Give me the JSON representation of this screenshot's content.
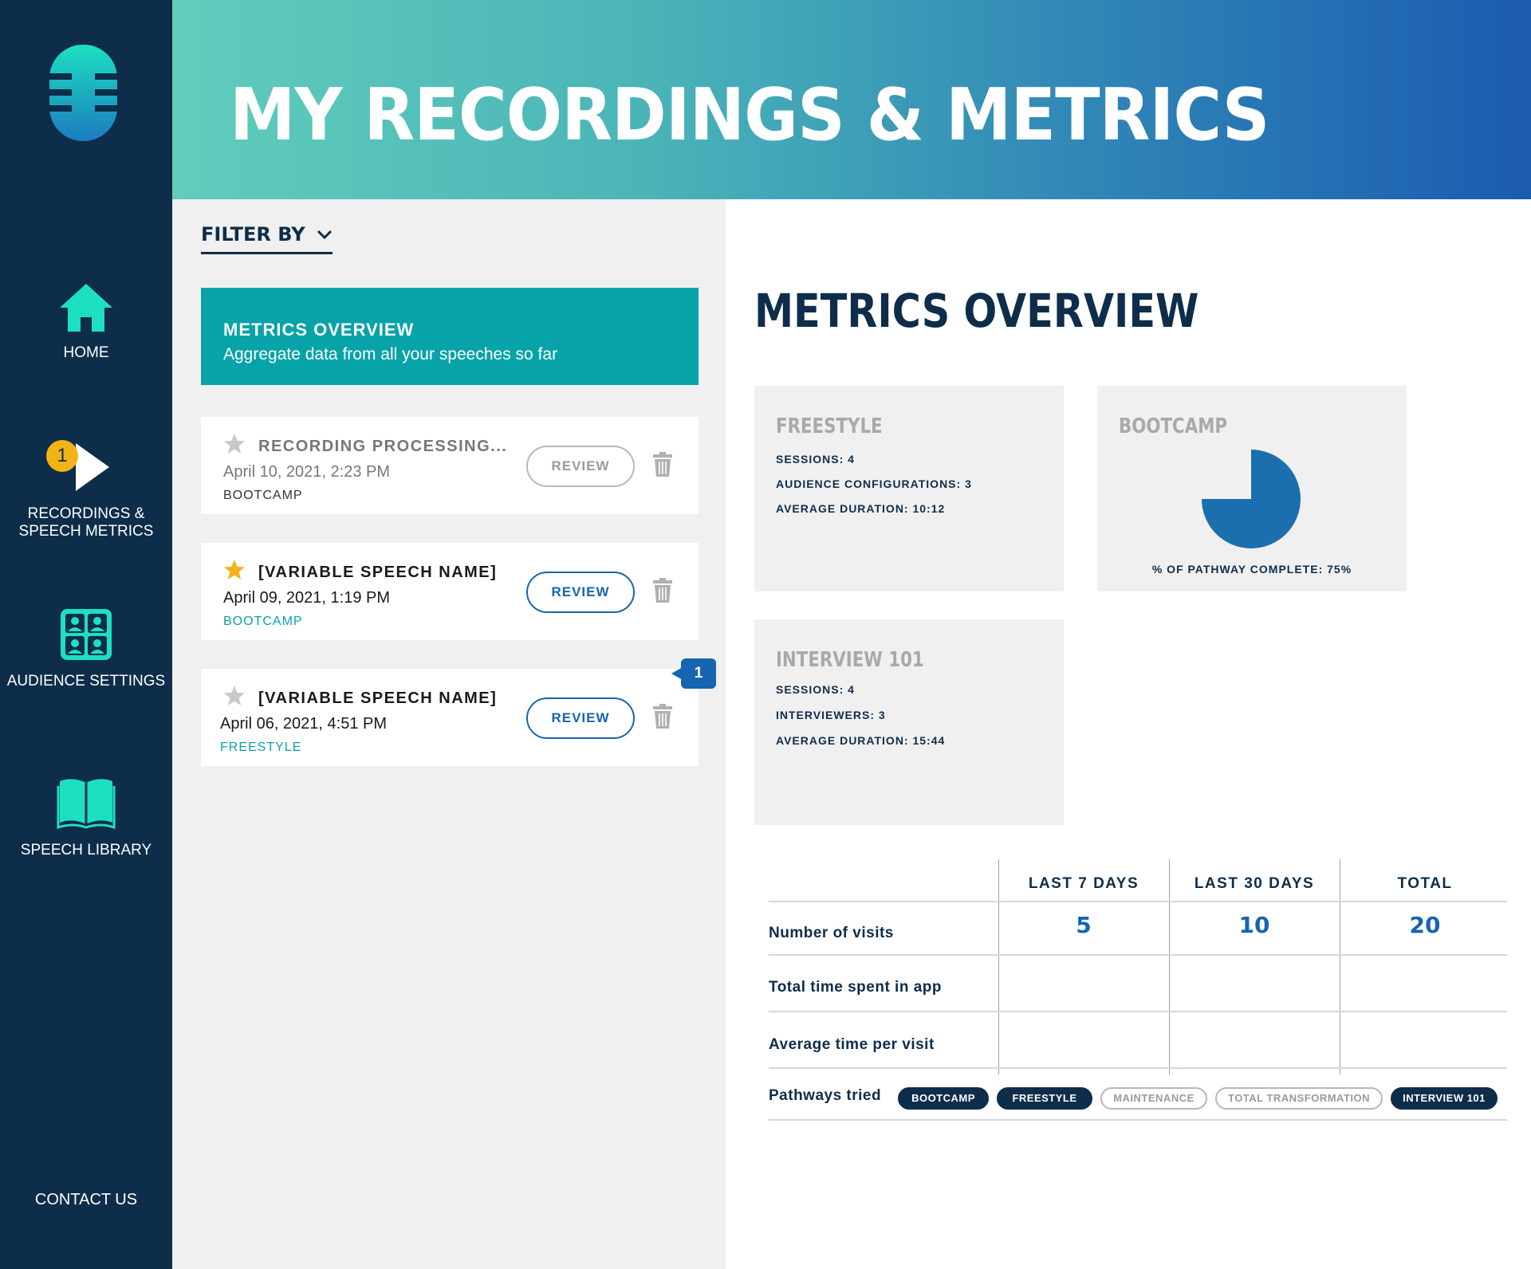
{
  "header": {
    "title": "MY RECORDINGS & METRICS"
  },
  "sidebar": {
    "items": [
      {
        "label": "HOME",
        "icon": "home-icon"
      },
      {
        "label": "RECORDINGS & SPEECH METRICS",
        "icon": "play-icon",
        "badge": "1"
      },
      {
        "label": "AUDIENCE SETTINGS",
        "icon": "audience-grid-icon"
      },
      {
        "label": "SPEECH LIBRARY",
        "icon": "book-icon"
      }
    ],
    "contact": "CONTACT US"
  },
  "filter": {
    "label": "FILTER BY"
  },
  "overview_card": {
    "title": "METRICS OVERVIEW",
    "subtitle": "Aggregate data from all your speeches so far"
  },
  "recordings": [
    {
      "title": "RECORDING PROCESSING...",
      "date": "April 10, 2021, 2:23 PM",
      "tag": "BOOTCAMP",
      "starred": false,
      "review": "REVIEW",
      "state": "processing"
    },
    {
      "title": "[VARIABLE SPEECH NAME]",
      "date": "April 09, 2021, 1:19 PM",
      "tag": "BOOTCAMP",
      "starred": true,
      "review": "REVIEW",
      "state": "ready"
    },
    {
      "title": "[VARIABLE SPEECH NAME]",
      "date": "April 06, 2021, 4:51 PM",
      "tag": "FREESTYLE",
      "starred": false,
      "review": "REVIEW",
      "state": "ready",
      "badge": "1"
    }
  ],
  "metrics": {
    "title": "METRICS OVERVIEW",
    "freestyle": {
      "title": "FREESTYLE",
      "lines": [
        "SESSIONS: 4",
        "AUDIENCE CONFIGURATIONS: 3",
        "AVERAGE DURATION: 10:12"
      ]
    },
    "bootcamp": {
      "title": "BOOTCAMP",
      "label": "% OF PATHWAY COMPLETE: 75%",
      "percent_complete": 75
    },
    "interview": {
      "title": "INTERVIEW 101",
      "lines": [
        "SESSIONS: 4",
        "INTERVIEWERS: 3",
        "AVERAGE DURATION: 15:44"
      ]
    }
  },
  "table": {
    "columns": [
      "LAST 7 DAYS",
      "LAST 30 DAYS",
      "TOTAL"
    ],
    "rows": [
      {
        "label": "Number of visits",
        "values": [
          "5",
          "10",
          "20"
        ]
      },
      {
        "label": "Total time spent in app",
        "values": [
          "",
          "",
          ""
        ]
      },
      {
        "label": "Average time per visit",
        "values": [
          "",
          "",
          ""
        ]
      }
    ],
    "pathways_label": "Pathways tried",
    "pathways": [
      {
        "label": "BOOTCAMP",
        "tried": true
      },
      {
        "label": "FREESTYLE",
        "tried": true
      },
      {
        "label": "MAINTENANCE",
        "tried": false
      },
      {
        "label": "TOTAL TRANSFORMATION",
        "tried": false
      },
      {
        "label": "INTERVIEW 101",
        "tried": true
      }
    ]
  },
  "colors": {
    "navy": "#0e2d4a",
    "teal": "#08a3a8",
    "accent_green": "#1de0c1",
    "blue": "#1565b0",
    "star_gold": "#f2b316",
    "card_gray": "#f0f0f0"
  }
}
